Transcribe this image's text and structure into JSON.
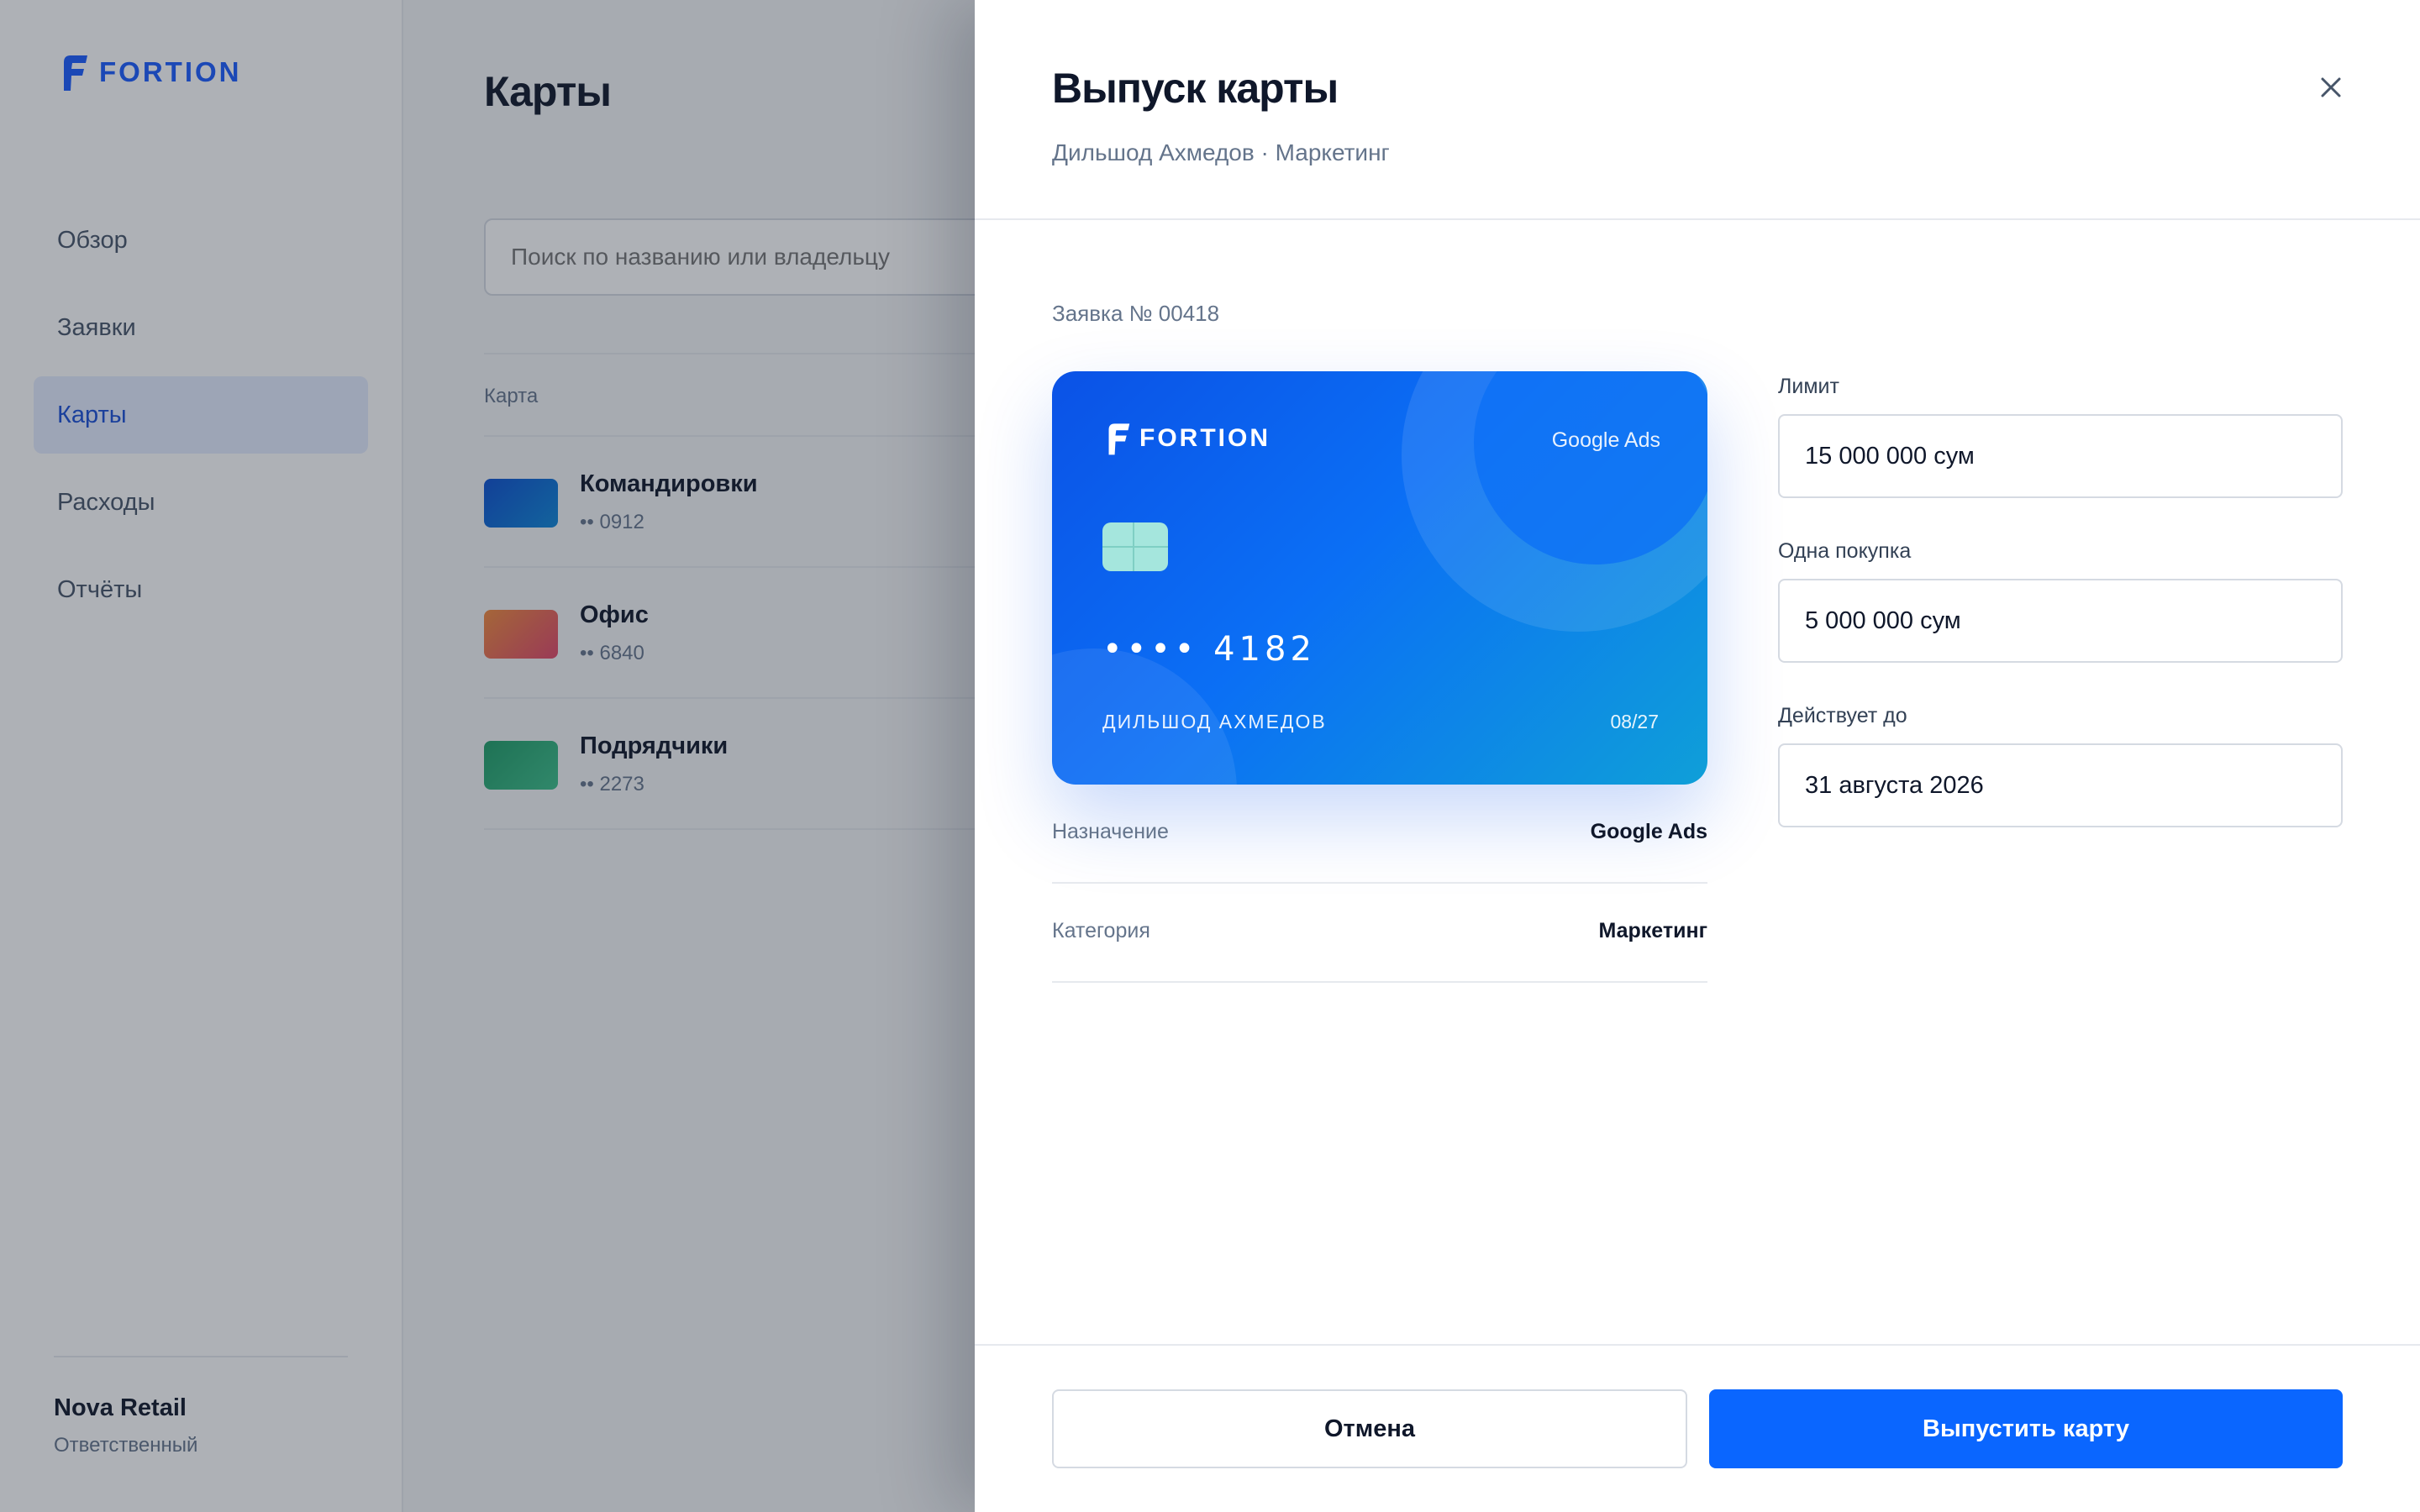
{
  "app": {
    "brand": "FORTION",
    "nav": [
      {
        "label": "Обзор",
        "active": false
      },
      {
        "label": "Заявки",
        "active": false
      },
      {
        "label": "Карты",
        "active": true
      },
      {
        "label": "Расходы",
        "active": false
      },
      {
        "label": "Отчёты",
        "active": false
      }
    ],
    "org": {
      "name": "Nova Retail",
      "role": "Ответственный"
    }
  },
  "page": {
    "title": "Карты",
    "search_placeholder": "Поиск по названию или владельцу",
    "table_header": "Карта",
    "rows": [
      {
        "name": "Командировки",
        "number": "•• 0912",
        "color": "#0b4fd0"
      },
      {
        "name": "Офис",
        "number": "•• 6840",
        "color": "#e0663f"
      },
      {
        "name": "Подрядчики",
        "number": "•• 2273",
        "color": "#1f9d67"
      }
    ]
  },
  "drawer": {
    "title": "Выпуск карты",
    "subtitle": "Дильшод Ахмедов · Маркетинг",
    "close_icon": "close-icon",
    "request_no": "Заявка № 00418",
    "card": {
      "brand": "FORTION",
      "purpose": "Google Ads",
      "number": "•••• 4182",
      "holder": "ДИЛЬШОД АХМЕДОВ",
      "expiry": "08/27"
    },
    "details": [
      {
        "key": "Назначение",
        "value": "Google Ads"
      },
      {
        "key": "Категория",
        "value": "Маркетинг"
      }
    ],
    "fields": {
      "limit": {
        "label": "Лимит",
        "value": "15 000 000 сум"
      },
      "single": {
        "label": "Одна покупка",
        "value": "5 000 000 сум"
      },
      "valid": {
        "label": "Действует до",
        "value": "31 августа 2026"
      }
    },
    "buttons": {
      "cancel": "Отмена",
      "issue": "Выпустить карту"
    }
  },
  "colors": {
    "accent": "#0a66ff",
    "brand": "#1a5cff"
  }
}
